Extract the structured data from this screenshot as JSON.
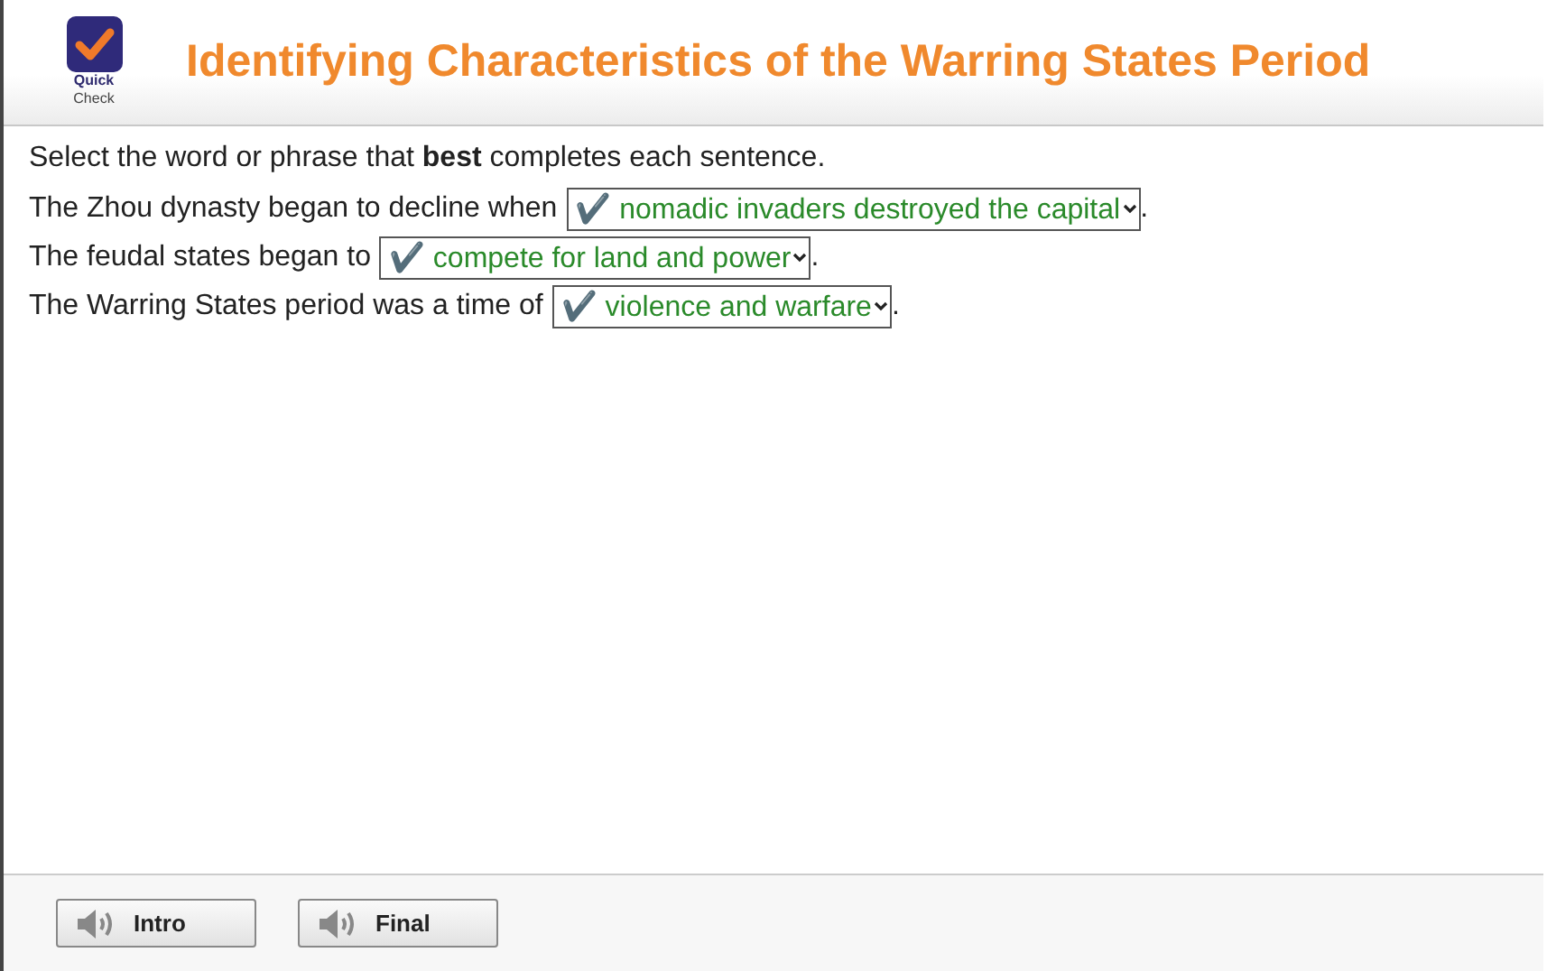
{
  "header": {
    "logo": {
      "line_1": "Quick",
      "line_2": "Check"
    },
    "title": "Identifying Characteristics of the Warring States Period"
  },
  "instructions": "Select the word or phrase that **best** completes each sentence.",
  "sentences": [
    {
      "before": "The Zhou dynasty began to decline when",
      "answer": "✔️ nomadic invaders destroyed the capital",
      "correct": true,
      "after": "."
    },
    {
      "before": "The feudal states began to",
      "answer": "✔️ compete for land and power",
      "correct": true,
      "after": "."
    },
    {
      "before": "The Warring States period was a time of",
      "answer": "✔️ violence and warfare",
      "correct": true,
      "after": "."
    }
  ],
  "footer_buttons": [
    {
      "label": "Intro"
    },
    {
      "label": "Final"
    }
  ]
}
